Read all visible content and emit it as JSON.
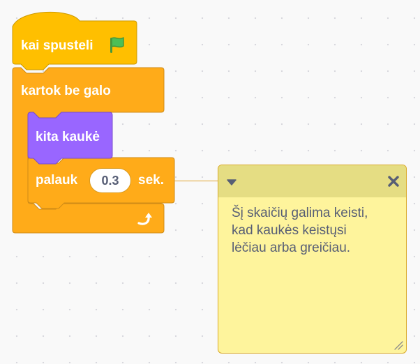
{
  "workspace": {
    "script": {
      "hat_block": {
        "label": "kai spusteli",
        "icon": "green-flag-icon",
        "color": "#ffbf00"
      },
      "forever_block": {
        "label": "kartok be galo",
        "icon": "loop-arrow-icon",
        "color": "#ffab19"
      },
      "looks_block": {
        "label": "kita kaukė",
        "color": "#9966ff"
      },
      "wait_block": {
        "label": "palauk",
        "input_value": "0.3",
        "unit_label": "sek.",
        "color": "#ffab19"
      }
    },
    "comment": {
      "text": "Šį skaičių galima keisti,\nkad kaukės keistųsi\nlėčiau arba greičiau.",
      "collapse_icon": "triangle-down-icon",
      "close_icon": "close-x-icon",
      "resize_icon": "resize-grip-icon",
      "colors": {
        "body": "#fef49c",
        "header": "#e5dd83",
        "border": "#d9a928"
      }
    }
  }
}
